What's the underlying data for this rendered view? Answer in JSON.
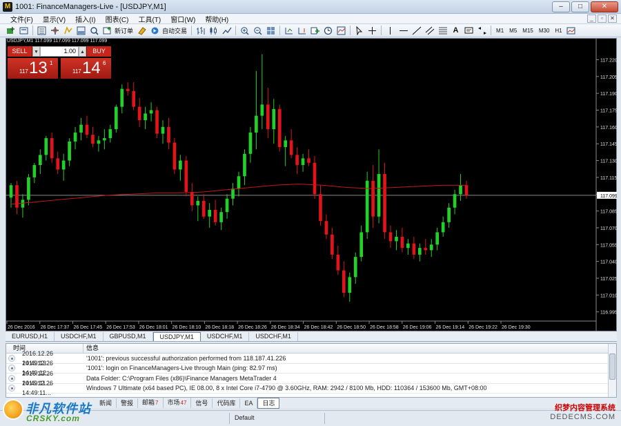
{
  "window": {
    "title": "1001: FinanceManagers-Live - [USDJPY,M1]",
    "app_icon": "M",
    "controls": {
      "minimize": "–",
      "maximize": "□",
      "close": "✕"
    }
  },
  "menu": {
    "items": [
      "文件(F)",
      "显示(V)",
      "插入(I)",
      "图表(C)",
      "工具(T)",
      "窗口(W)",
      "帮助(H)"
    ],
    "right_buttons": [
      "_",
      "▫",
      "✕"
    ]
  },
  "toolbar": {
    "new_order_label": "新订单",
    "auto_trade_label": "自动交易",
    "timeframes": [
      "M1",
      "M5",
      "M15",
      "M30",
      "H1"
    ]
  },
  "chart_data": {
    "type": "candlestick",
    "symbol_header": "USDJPY,M1  117.099 117.099 117.099 117.099",
    "current_price": 117.099,
    "ylim": [
      116.988,
      117.232
    ],
    "y_ticks": [
      117.22,
      117.205,
      117.19,
      117.175,
      117.16,
      117.145,
      117.13,
      117.115,
      117.1,
      117.085,
      117.07,
      117.055,
      117.04,
      117.025,
      117.01,
      116.995
    ],
    "y_tick_labels": [
      "117.220",
      "117.205",
      "117.190",
      "117.175",
      "117.160",
      "117.145",
      "117.130",
      "117.115",
      "117.099",
      "117.085",
      "117.070",
      "117.055",
      "117.040",
      "117.025",
      "117.010",
      "116.995"
    ],
    "x_tick_labels": [
      "26 Dec 2016",
      "26 Dec 17:37",
      "26 Dec 17:45",
      "26 Dec 17:53",
      "26 Dec 18:01",
      "26 Dec 18:10",
      "26 Dec 18:18",
      "26 Dec 18:26",
      "26 Dec 18:34",
      "26 Dec 18:42",
      "26 Dec 18:50",
      "26 Dec 18:58",
      "26 Dec 19:06",
      "26 Dec 19:14",
      "26 Dec 19:22",
      "26 Dec 19:30"
    ],
    "candles": [
      [
        117.097,
        117.11,
        117.088,
        117.108
      ],
      [
        117.108,
        117.112,
        117.082,
        117.088
      ],
      [
        117.088,
        117.1,
        117.079,
        117.095
      ],
      [
        117.095,
        117.118,
        117.09,
        117.115
      ],
      [
        117.115,
        117.128,
        117.11,
        117.126
      ],
      [
        117.126,
        117.14,
        117.118,
        117.135
      ],
      [
        117.135,
        117.152,
        117.13,
        117.15
      ],
      [
        117.15,
        117.155,
        117.128,
        117.132
      ],
      [
        117.132,
        117.138,
        117.118,
        117.122
      ],
      [
        117.122,
        117.136,
        117.112,
        117.13
      ],
      [
        117.13,
        117.15,
        117.125,
        117.147
      ],
      [
        117.147,
        117.16,
        117.14,
        117.155
      ],
      [
        117.155,
        117.168,
        117.148,
        117.162
      ],
      [
        117.162,
        117.17,
        117.15,
        117.153
      ],
      [
        117.153,
        117.16,
        117.142,
        117.145
      ],
      [
        117.145,
        117.152,
        117.138,
        117.148
      ],
      [
        117.148,
        117.158,
        117.14,
        117.15
      ],
      [
        117.15,
        117.162,
        117.146,
        117.158
      ],
      [
        117.158,
        117.18,
        117.155,
        117.178
      ],
      [
        117.178,
        117.198,
        117.172,
        117.194
      ],
      [
        117.194,
        117.2,
        117.188,
        117.192
      ],
      [
        117.192,
        117.2,
        117.175,
        117.178
      ],
      [
        117.178,
        117.186,
        117.16,
        117.166
      ],
      [
        117.166,
        117.178,
        117.158,
        117.172
      ],
      [
        117.172,
        117.182,
        117.165,
        117.175
      ],
      [
        117.175,
        117.178,
        117.15,
        117.154
      ],
      [
        117.154,
        117.166,
        117.145,
        117.16
      ],
      [
        117.16,
        117.168,
        117.14,
        117.146
      ],
      [
        117.146,
        117.15,
        117.118,
        117.122
      ],
      [
        117.122,
        117.135,
        117.112,
        117.13
      ],
      [
        117.13,
        117.134,
        117.098,
        117.102
      ],
      [
        117.102,
        117.11,
        117.085,
        117.09
      ],
      [
        117.09,
        117.098,
        117.076,
        117.094
      ],
      [
        117.094,
        117.1,
        117.078,
        117.08
      ],
      [
        117.08,
        117.092,
        117.07,
        117.086
      ],
      [
        117.086,
        117.095,
        117.072,
        117.075
      ],
      [
        117.075,
        117.088,
        117.068,
        117.084
      ],
      [
        117.084,
        117.1,
        117.078,
        117.096
      ],
      [
        117.096,
        117.11,
        117.09,
        117.105
      ],
      [
        117.105,
        117.12,
        117.098,
        117.116
      ],
      [
        117.116,
        117.14,
        117.108,
        117.136
      ],
      [
        117.136,
        117.16,
        117.128,
        117.155
      ],
      [
        117.155,
        117.21,
        117.14,
        117.17
      ],
      [
        117.17,
        117.225,
        117.158,
        117.18
      ],
      [
        117.18,
        117.195,
        117.15,
        117.158
      ],
      [
        117.158,
        117.185,
        117.145,
        117.176
      ],
      [
        117.176,
        117.18,
        117.138,
        117.142
      ],
      [
        117.142,
        117.152,
        117.125,
        117.148
      ],
      [
        117.148,
        117.158,
        117.132,
        117.135
      ],
      [
        117.135,
        117.142,
        117.118,
        117.126
      ],
      [
        117.126,
        117.136,
        117.12,
        117.132
      ],
      [
        117.132,
        117.14,
        117.125,
        117.128
      ],
      [
        117.128,
        117.134,
        117.096,
        117.1
      ],
      [
        117.1,
        117.108,
        117.072,
        117.076
      ],
      [
        117.076,
        117.082,
        117.06,
        117.064
      ],
      [
        117.064,
        117.07,
        117.042,
        117.046
      ],
      [
        117.046,
        117.054,
        117.028,
        117.032
      ],
      [
        117.032,
        117.04,
        117.008,
        117.012
      ],
      [
        117.012,
        117.03,
        117.004,
        117.026
      ],
      [
        117.026,
        117.048,
        117.02,
        117.044
      ],
      [
        117.044,
        117.072,
        117.04,
        117.066
      ],
      [
        117.066,
        117.12,
        117.06,
        117.112
      ],
      [
        117.112,
        117.126,
        117.07,
        117.08
      ],
      [
        117.08,
        117.14,
        117.074,
        117.118
      ],
      [
        117.118,
        117.128,
        117.06,
        117.066
      ],
      [
        117.066,
        117.072,
        117.052,
        117.058
      ],
      [
        117.058,
        117.068,
        117.05,
        117.062
      ],
      [
        117.062,
        117.07,
        117.048,
        117.052
      ],
      [
        117.052,
        117.06,
        117.046,
        117.056
      ],
      [
        117.056,
        117.062,
        117.042,
        117.046
      ],
      [
        117.046,
        117.056,
        117.04,
        117.052
      ],
      [
        117.052,
        117.06,
        117.046,
        117.05
      ],
      [
        117.05,
        117.06,
        117.044,
        117.055
      ],
      [
        117.055,
        117.07,
        117.05,
        117.066
      ],
      [
        117.066,
        117.08,
        117.062,
        117.075
      ],
      [
        117.075,
        117.092,
        117.07,
        117.088
      ],
      [
        117.088,
        117.104,
        117.082,
        117.1
      ],
      [
        117.1,
        117.118,
        117.094,
        117.108
      ],
      [
        117.108,
        117.112,
        117.096,
        117.099
      ]
    ],
    "ma": [
      117.091,
      117.093,
      117.095,
      117.097,
      117.099,
      117.1,
      117.101,
      117.101,
      117.102,
      117.104,
      117.106,
      117.108,
      117.109,
      117.108,
      117.106,
      117.105,
      117.106,
      117.107,
      117.108,
      117.108
    ],
    "colors": {
      "up": "#22d02a",
      "down": "#e0141a",
      "ma": "#c01a1a",
      "price_line": "#b9b9b9",
      "axis_text": "#e0e0e0"
    }
  },
  "trade_panel": {
    "sell_label": "SELL",
    "buy_label": "BUY",
    "lot": "1.00",
    "sell_prefix": "117",
    "sell_big": "13",
    "sell_sup": "1",
    "buy_prefix": "117",
    "buy_big": "14",
    "buy_sup": "6"
  },
  "chart_tabs": [
    "EURUSD,H1",
    "USDCHF,M1",
    "GBPUSD,M1",
    "USDJPY,M1",
    "USDCHF,M1",
    "USDCHF,M1"
  ],
  "terminal": {
    "col_time": "时间",
    "col_msg": "信息",
    "rows": [
      {
        "time": "2016.12.26 14:49:13...",
        "msg": "'1001': previous successful authorization performed from 118.187.41.226"
      },
      {
        "time": "2016.12.26 14:49:12...",
        "msg": "'1001': login on FinanceManagers-Live through Main (ping: 82.97 ms)"
      },
      {
        "time": "2016.12.26 14:49:11...",
        "msg": "Data Folder: C:\\Program Files (x86)\\Finance Managers MetaTrader 4"
      },
      {
        "time": "2016.12.26 14:49:11...",
        "msg": "Windows 7 Ultimate (x64 based PC), IE 08.00, 8 x Intel Core i7-4790  @ 3.60GHz, RAM: 2942 / 8100 Mb, HDD: 110364 / 153600 Mb, GMT+08:00"
      }
    ],
    "tabs": [
      {
        "label": "新闻",
        "badge": ""
      },
      {
        "label": "警报",
        "badge": ""
      },
      {
        "label": "邮箱",
        "badge": "7"
      },
      {
        "label": "市场",
        "badge": "47"
      },
      {
        "label": "信号",
        "badge": ""
      },
      {
        "label": "代码库",
        "badge": ""
      },
      {
        "label": "EA",
        "badge": ""
      },
      {
        "label": "日志",
        "badge": ""
      }
    ]
  },
  "status": {
    "profile": "Default"
  },
  "watermark": {
    "left_main": "非凡软件站",
    "left_sub": "CRSKY.com",
    "right_line1": "织梦内容管理系统",
    "right_line2": "DEDECMS.COM"
  }
}
